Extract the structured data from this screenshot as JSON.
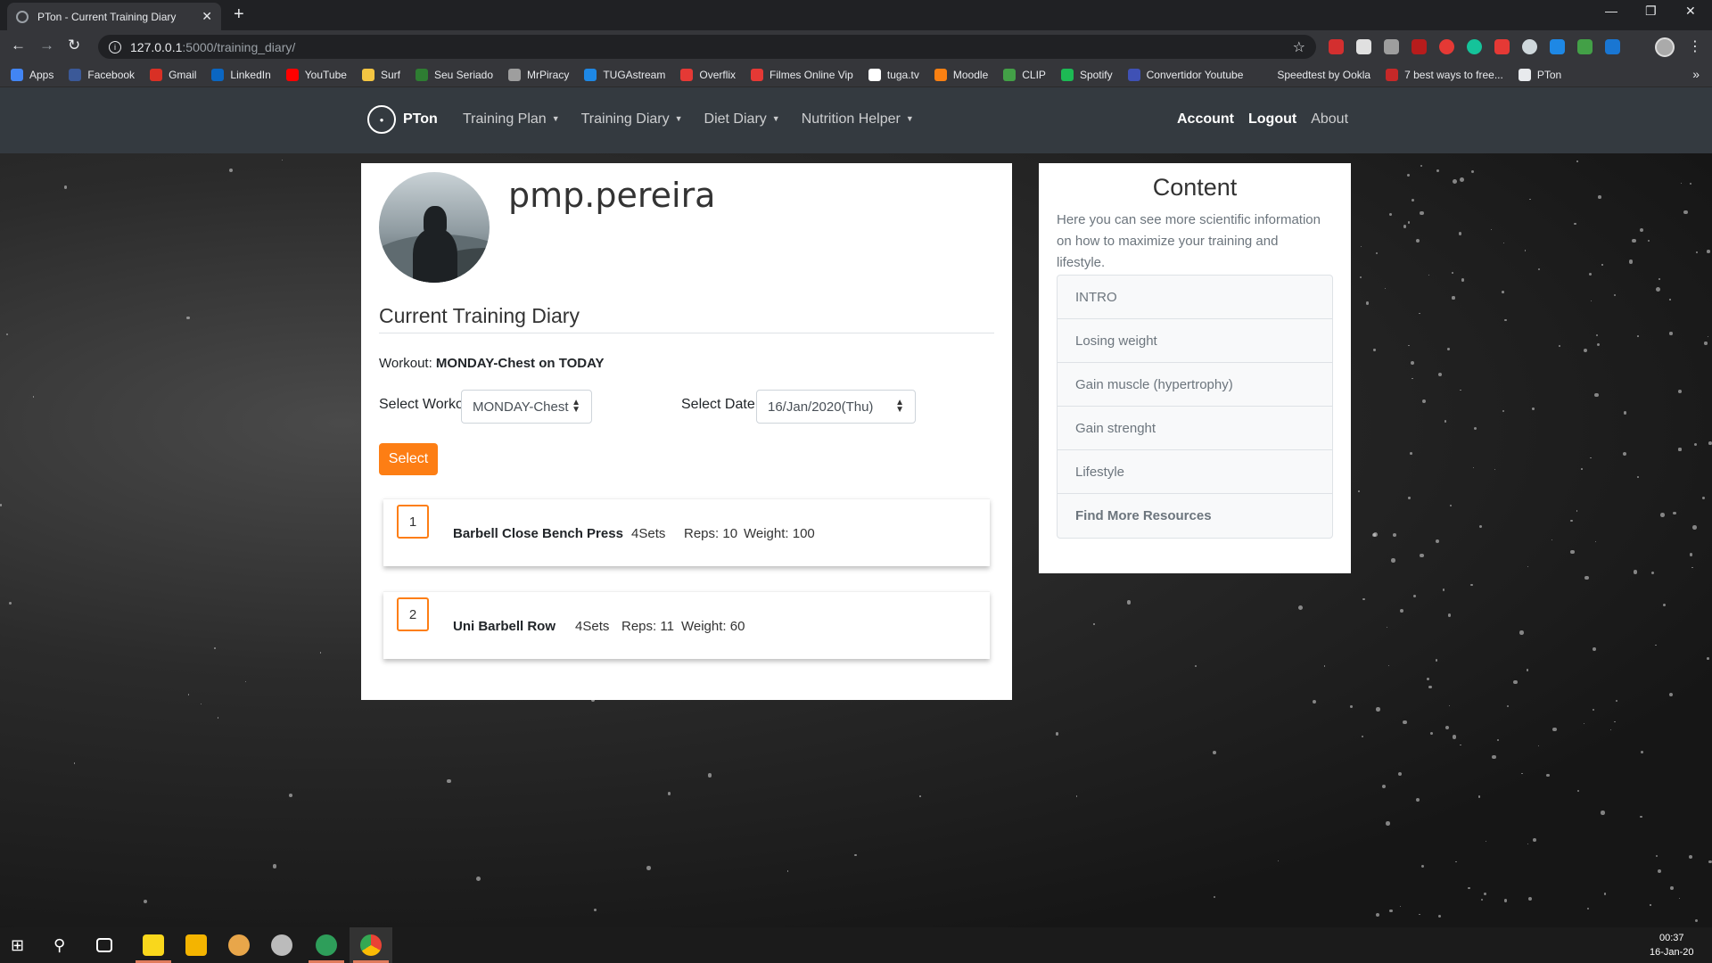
{
  "browser": {
    "tab_title": "PTon - Current Training Diary",
    "close_glyph": "✕",
    "newtab_glyph": "+",
    "url_host": "127.0.0.1",
    "url_path": ":5000/training_diary/",
    "bookmarks": [
      {
        "label": "Apps",
        "color": "#4285f4"
      },
      {
        "label": "Facebook",
        "color": "#3b5998"
      },
      {
        "label": "Gmail",
        "color": "#d93025"
      },
      {
        "label": "LinkedIn",
        "color": "#0a66c2"
      },
      {
        "label": "YouTube",
        "color": "#ff0000"
      },
      {
        "label": "Surf",
        "color": "#f4c542"
      },
      {
        "label": "Seu Seriado",
        "color": "#2e7d32"
      },
      {
        "label": "MrPiracy",
        "color": "#9e9e9e"
      },
      {
        "label": "TUGAstream",
        "color": "#1e88e5"
      },
      {
        "label": "Overflix",
        "color": "#e53935"
      },
      {
        "label": "Filmes Online Vip",
        "color": "#e53935"
      },
      {
        "label": "tuga.tv",
        "color": "#ffffff"
      },
      {
        "label": "Moodle",
        "color": "#f98012"
      },
      {
        "label": "CLIP",
        "color": "#43a047"
      },
      {
        "label": "Spotify",
        "color": "#1db954"
      },
      {
        "label": "Convertidor Youtube",
        "color": "#3f51b5"
      },
      {
        "label": "Speedtest by Ookla",
        "color": "#35363a"
      },
      {
        "label": "7 best ways to free...",
        "color": "#c62828"
      },
      {
        "label": "PTon",
        "color": "#e8eaed"
      }
    ]
  },
  "nav": {
    "brand": "PTon",
    "menu": [
      {
        "label": "Training Plan"
      },
      {
        "label": "Training Diary"
      },
      {
        "label": "Diet Diary"
      },
      {
        "label": "Nutrition Helper"
      }
    ],
    "account": "Account",
    "logout": "Logout",
    "about": "About"
  },
  "profile": {
    "username": "pmp.pereira"
  },
  "diary": {
    "title": "Current Training Diary",
    "workout_label": "Workout:",
    "workout_value": "MONDAY-Chest on TODAY",
    "select_workout_label": "Select Workout",
    "select_workout_value": "MONDAY-Chest",
    "select_date_label": "Select Date",
    "select_date_value": "16/Jan/2020(Thu)",
    "select_button": "Select",
    "exercises": [
      {
        "num": "1",
        "name": "Barbell Close Bench Press",
        "sets": "4Sets",
        "reps": "Reps: 10",
        "weight": "Weight: 100"
      },
      {
        "num": "2",
        "name": "Uni Barbell Row",
        "sets": "4Sets",
        "reps": "Reps: 11",
        "weight": "Weight: 60"
      }
    ]
  },
  "content": {
    "title": "Content",
    "description": "Here you can see more scientific information on how to maximize your training and lifestyle.",
    "items": [
      {
        "label": "INTRO"
      },
      {
        "label": "Losing weight"
      },
      {
        "label": "Gain muscle (hypertrophy)"
      },
      {
        "label": "Gain strenght"
      },
      {
        "label": "Lifestyle"
      },
      {
        "label": "Find More Resources"
      }
    ]
  },
  "taskbar": {
    "time": "00:37",
    "date": "16-Jan-20"
  },
  "colors": {
    "accent": "#fd7e14",
    "navbar": "#343a40"
  }
}
